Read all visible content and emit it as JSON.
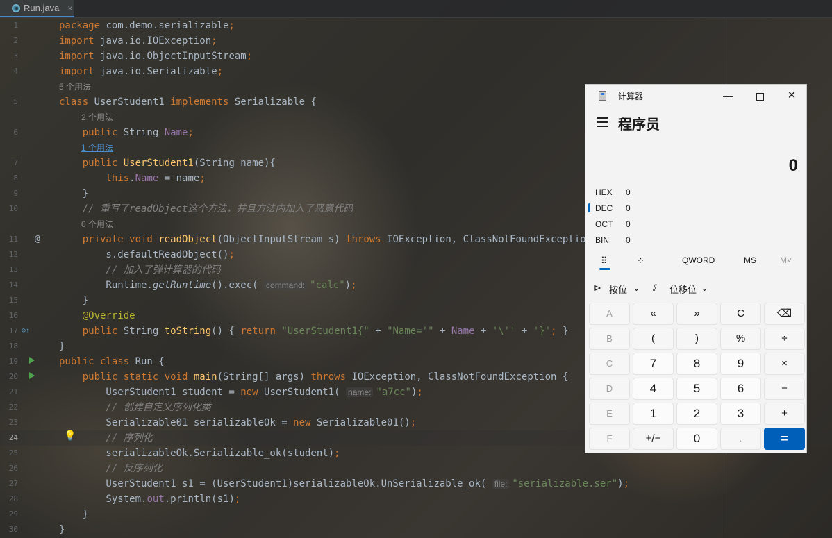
{
  "tab": {
    "label": "Run.java",
    "close": "×"
  },
  "code": [
    {
      "n": "1",
      "parts": [
        [
          "package ",
          "kw"
        ],
        [
          "com.demo.serializable",
          ""
        ],
        [
          ";",
          "kw"
        ]
      ]
    },
    {
      "n": "2",
      "parts": [
        [
          "import ",
          "kw"
        ],
        [
          "java.io.IOException",
          ""
        ],
        [
          ";",
          "kw"
        ]
      ]
    },
    {
      "n": "3",
      "parts": [
        [
          "import ",
          "kw"
        ],
        [
          "java.io.ObjectInputStream",
          ""
        ],
        [
          ";",
          "kw"
        ]
      ]
    },
    {
      "n": "4",
      "parts": [
        [
          "import ",
          "kw"
        ],
        [
          "java.io.Serializable",
          ""
        ],
        [
          ";",
          "kw"
        ]
      ]
    },
    {
      "hint": "5 个用法",
      "indent": 0
    },
    {
      "n": "5",
      "parts": [
        [
          "class ",
          "kw"
        ],
        [
          "UserStudent1 ",
          ""
        ],
        [
          "implements ",
          "kw"
        ],
        [
          "Serializable {",
          ""
        ]
      ]
    },
    {
      "hint": "2 个用法",
      "indent": 1
    },
    {
      "n": "6",
      "parts": [
        [
          "    public ",
          "kw"
        ],
        [
          "String ",
          ""
        ],
        [
          "Name",
          "fd"
        ],
        [
          ";",
          "kw"
        ]
      ]
    },
    {
      "hint": "1 个用法",
      "indent": 1,
      "link": true
    },
    {
      "n": "7",
      "parts": [
        [
          "    public ",
          "kw"
        ],
        [
          "UserStudent1",
          "fn"
        ],
        [
          "(String name){",
          ""
        ]
      ]
    },
    {
      "n": "8",
      "parts": [
        [
          "        this",
          "kw"
        ],
        [
          ".",
          ""
        ],
        [
          "Name",
          "fd"
        ],
        [
          " = name",
          ""
        ],
        [
          ";",
          "kw"
        ]
      ]
    },
    {
      "n": "9",
      "parts": [
        [
          "    }",
          ""
        ]
      ]
    },
    {
      "n": "10",
      "parts": [
        [
          "    // 重写了",
          "cm"
        ],
        [
          "readObject",
          "cm"
        ],
        [
          "这个方法，并且方法内加入了恶意代码",
          "cm"
        ]
      ]
    },
    {
      "hint": "0 个用法",
      "indent": 1
    },
    {
      "n": "11",
      "gutter": "@",
      "parts": [
        [
          "    private void ",
          "kw"
        ],
        [
          "readObject",
          "fn"
        ],
        [
          "(ObjectInputStream s) ",
          ""
        ],
        [
          "throws ",
          "kw"
        ],
        [
          "IOException, ClassNotFoundException {",
          ""
        ]
      ]
    },
    {
      "n": "12",
      "parts": [
        [
          "        s.defaultReadObject()",
          ""
        ],
        [
          ";",
          "kw"
        ]
      ]
    },
    {
      "n": "13",
      "parts": [
        [
          "        // 加入了弹计算器的代码",
          "cm"
        ]
      ]
    },
    {
      "n": "14",
      "parts": [
        [
          "        Runtime.",
          ""
        ],
        [
          "getRuntime",
          "it"
        ],
        [
          "().exec( ",
          ""
        ],
        [
          "command:",
          "inlay"
        ],
        [
          "\"calc\"",
          "st"
        ],
        [
          ")",
          ""
        ],
        [
          ";",
          "kw"
        ]
      ]
    },
    {
      "n": "15",
      "parts": [
        [
          "    }",
          ""
        ]
      ]
    },
    {
      "n": "16",
      "parts": [
        [
          "    @Override",
          "an"
        ]
      ]
    },
    {
      "n": "17",
      "gutter": "o↑",
      "parts": [
        [
          "    public ",
          "kw"
        ],
        [
          "String ",
          ""
        ],
        [
          "toString",
          "fn"
        ],
        [
          "() { ",
          ""
        ],
        [
          "return ",
          "kw"
        ],
        [
          "\"UserStudent1{\"",
          "st"
        ],
        [
          " + ",
          ""
        ],
        [
          "\"Name='\"",
          "st"
        ],
        [
          " + ",
          ""
        ],
        [
          "Name",
          "fd"
        ],
        [
          " + ",
          ""
        ],
        [
          "'\\''",
          "st"
        ],
        [
          " + ",
          ""
        ],
        [
          "'}'",
          "st"
        ],
        [
          "; ",
          "kw"
        ],
        [
          "}",
          ""
        ]
      ]
    },
    {
      "n": "18",
      "parts": [
        [
          "}",
          ""
        ]
      ]
    },
    {
      "n": "19",
      "gutter": "run",
      "parts": [
        [
          "public class ",
          "kw"
        ],
        [
          "Run {",
          ""
        ]
      ]
    },
    {
      "n": "20",
      "gutter": "run",
      "parts": [
        [
          "    public static void ",
          "kw"
        ],
        [
          "main",
          "fn"
        ],
        [
          "(String[] args) ",
          ""
        ],
        [
          "throws ",
          "kw"
        ],
        [
          "IOException, ClassNotFoundException {",
          ""
        ]
      ]
    },
    {
      "n": "21",
      "parts": [
        [
          "        UserStudent1 student = ",
          ""
        ],
        [
          "new ",
          "kw"
        ],
        [
          "UserStudent1( ",
          ""
        ],
        [
          "name:",
          "inlay"
        ],
        [
          "\"a7cc\"",
          "st"
        ],
        [
          ")",
          ""
        ],
        [
          ";",
          "kw"
        ]
      ]
    },
    {
      "n": "22",
      "parts": [
        [
          "        // 创建自定义序列化类",
          "cm"
        ]
      ]
    },
    {
      "n": "23",
      "parts": [
        [
          "        Serializable01 serializableOk = ",
          ""
        ],
        [
          "new ",
          "kw"
        ],
        [
          "Serializable01()",
          ""
        ],
        [
          ";",
          "kw"
        ]
      ]
    },
    {
      "n": "24",
      "gutter": "bulb",
      "caret": true,
      "parts": [
        [
          "        // 序列化",
          "cm"
        ]
      ]
    },
    {
      "n": "25",
      "parts": [
        [
          "        serializableOk.Serializable_ok(student)",
          ""
        ],
        [
          ";",
          "kw"
        ]
      ]
    },
    {
      "n": "26",
      "parts": [
        [
          "        // 反序列化",
          "cm"
        ]
      ]
    },
    {
      "n": "27",
      "parts": [
        [
          "        UserStudent1 s1 = (UserStudent1)serializableOk.UnSerializable_ok( ",
          ""
        ],
        [
          "file:",
          "inlay"
        ],
        [
          "\"serializable.ser\"",
          "st"
        ],
        [
          ")",
          ""
        ],
        [
          ";",
          "kw"
        ]
      ]
    },
    {
      "n": "28",
      "parts": [
        [
          "        System.",
          ""
        ],
        [
          "out",
          "fd"
        ],
        [
          ".println(s1)",
          ""
        ],
        [
          ";",
          "kw"
        ]
      ]
    },
    {
      "n": "29",
      "parts": [
        [
          "    }",
          ""
        ]
      ]
    },
    {
      "n": "30",
      "parts": [
        [
          "}",
          ""
        ]
      ]
    }
  ],
  "calculator": {
    "title": "计算器",
    "mode": "程序员",
    "display": "0",
    "radix": [
      {
        "label": "HEX",
        "value": "0"
      },
      {
        "label": "DEC",
        "value": "0"
      },
      {
        "label": "OCT",
        "value": "0"
      },
      {
        "label": "BIN",
        "value": "0"
      }
    ],
    "tools": {
      "word": "QWORD",
      "ms": "MS",
      "mv": "M˅"
    },
    "ops": {
      "bitwise": "按位",
      "shift": "位移位"
    },
    "keys": [
      [
        "A",
        "«",
        "»",
        "C",
        "⌫"
      ],
      [
        "B",
        "(",
        ")",
        "%",
        "÷"
      ],
      [
        "C",
        "7",
        "8",
        "9",
        "×"
      ],
      [
        "D",
        "4",
        "5",
        "6",
        "−"
      ],
      [
        "E",
        "1",
        "2",
        "3",
        "+"
      ],
      [
        "F",
        "+/−",
        "0",
        ".",
        "="
      ]
    ],
    "colors": {
      "accent": "#005fb8",
      "window": "#f3f3f3"
    }
  }
}
